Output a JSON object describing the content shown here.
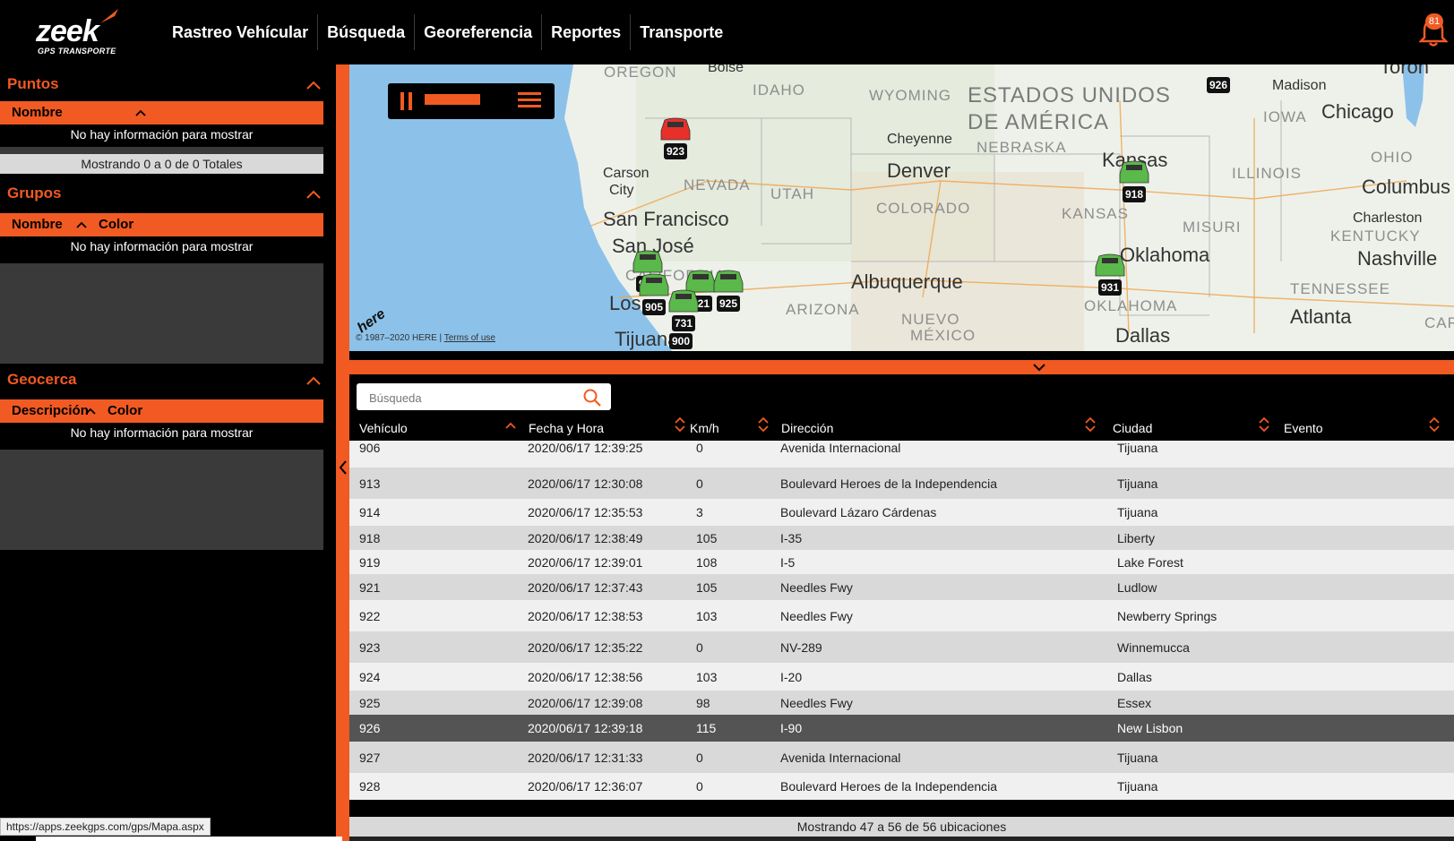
{
  "brand": {
    "logo_text": "zeek",
    "logo_sub": "GPS TRANSPORTE",
    "accent_color": "#f15a22"
  },
  "nav": {
    "items": [
      "Rastreo Vehícular",
      "Búsqueda",
      "Georeferencia",
      "Reportes",
      "Transporte"
    ]
  },
  "notifications": {
    "count": "81"
  },
  "left": {
    "puntos": {
      "title": "Puntos",
      "col1": "Nombre",
      "empty": "No hay información para mostrar",
      "footer": "Mostrando 0 a 0 de 0 Totales"
    },
    "grupos": {
      "title": "Grupos",
      "col1": "Nombre",
      "col2": "Color",
      "empty": "No hay información para mostrar"
    },
    "geocerca": {
      "title": "Geocerca",
      "col1": "Descripción",
      "col2": "Color",
      "empty": "No hay información para mostrar"
    }
  },
  "map": {
    "copyright": "© 1987–2020 HERE |",
    "terms": "Terms of use",
    "here_logo": "here",
    "labels": [
      {
        "text": "OREGON",
        "kind": "state"
      },
      {
        "text": "Boise",
        "kind": "city"
      },
      {
        "text": "IDAHO",
        "kind": "state"
      },
      {
        "text": "WYOMING",
        "kind": "state"
      },
      {
        "text": "ESTADOS UNIDOS",
        "kind": "country"
      },
      {
        "text": "DE AMÉRICA",
        "kind": "country"
      },
      {
        "text": "IOWA",
        "kind": "state"
      },
      {
        "text": "Madison",
        "kind": "city"
      },
      {
        "text": "Chicago",
        "kind": "bigcity"
      },
      {
        "text": "Cheyenne",
        "kind": "city"
      },
      {
        "text": "NEBRASKA",
        "kind": "state"
      },
      {
        "text": "Carson",
        "kind": "city"
      },
      {
        "text": "City",
        "kind": "city"
      },
      {
        "text": "NEVADA",
        "kind": "state"
      },
      {
        "text": "Denver",
        "kind": "bigcity"
      },
      {
        "text": "Kansas",
        "kind": "bigcity"
      },
      {
        "text": "ILLINOIS",
        "kind": "state"
      },
      {
        "text": "OHIO",
        "kind": "state"
      },
      {
        "text": "Columbus",
        "kind": "bigcity"
      },
      {
        "text": "UTAH",
        "kind": "state"
      },
      {
        "text": "San Francisco",
        "kind": "bigcity"
      },
      {
        "text": "COLORADO",
        "kind": "state"
      },
      {
        "text": "KANSAS",
        "kind": "state"
      },
      {
        "text": "MISURI",
        "kind": "state"
      },
      {
        "text": "Charleston",
        "kind": "city"
      },
      {
        "text": "KENTUCKY",
        "kind": "state"
      },
      {
        "text": "San José",
        "kind": "bigcity"
      },
      {
        "text": "Oklahoma",
        "kind": "bigcity"
      },
      {
        "text": "Nashville",
        "kind": "bigcity"
      },
      {
        "text": "CALIFORNIA",
        "kind": "state"
      },
      {
        "text": "Albuquerque",
        "kind": "bigcity"
      },
      {
        "text": "TENNESSEE",
        "kind": "state"
      },
      {
        "text": "Los",
        "kind": "bigcity"
      },
      {
        "text": "ARIZONA",
        "kind": "state"
      },
      {
        "text": "NUEVO",
        "kind": "state"
      },
      {
        "text": "OKLAHOMA",
        "kind": "state"
      },
      {
        "text": "Atlanta",
        "kind": "bigcity"
      },
      {
        "text": "MÉXICO",
        "kind": "state"
      },
      {
        "text": "Dallas",
        "kind": "bigcity"
      },
      {
        "text": "Tijuana",
        "kind": "bigcity"
      },
      {
        "text": "Toron",
        "kind": "bigcity"
      },
      {
        "text": "CARO",
        "kind": "state"
      }
    ],
    "vehicles": [
      {
        "id": "926",
        "status": "none"
      },
      {
        "id": "923",
        "status": "red"
      },
      {
        "id": "918",
        "status": "green"
      },
      {
        "id": "903",
        "status": "green"
      },
      {
        "id": "905",
        "status": "green"
      },
      {
        "id": "921",
        "status": "green"
      },
      {
        "id": "925",
        "status": "green"
      },
      {
        "id": "931",
        "status": "green"
      },
      {
        "id": "731",
        "status": "green"
      },
      {
        "id": "900",
        "status": "red"
      }
    ]
  },
  "table": {
    "search_placeholder": "Búsqueda",
    "headers": [
      "Vehículo",
      "Fecha y Hora",
      "Km/h",
      "Dirección",
      "Ciudad",
      "Evento"
    ],
    "rows": [
      {
        "veh": "906",
        "fecha": "2020/06/17 12:39:25",
        "kmh": "0",
        "dir": "Avenida Internacional",
        "ciudad": "Tijuana",
        "evento": ""
      },
      {
        "veh": "913",
        "fecha": "2020/06/17 12:30:08",
        "kmh": "0",
        "dir": "Boulevard Heroes de la Independencia",
        "ciudad": "Tijuana",
        "evento": ""
      },
      {
        "veh": "914",
        "fecha": "2020/06/17 12:35:53",
        "kmh": "3",
        "dir": "Boulevard Lázaro Cárdenas",
        "ciudad": "Tijuana",
        "evento": ""
      },
      {
        "veh": "918",
        "fecha": "2020/06/17 12:38:49",
        "kmh": "105",
        "dir": "I-35",
        "ciudad": "Liberty",
        "evento": ""
      },
      {
        "veh": "919",
        "fecha": "2020/06/17 12:39:01",
        "kmh": "108",
        "dir": "I-5",
        "ciudad": "Lake Forest",
        "evento": ""
      },
      {
        "veh": "921",
        "fecha": "2020/06/17 12:37:43",
        "kmh": "105",
        "dir": "Needles Fwy",
        "ciudad": "Ludlow",
        "evento": ""
      },
      {
        "veh": "922",
        "fecha": "2020/06/17 12:38:53",
        "kmh": "103",
        "dir": "Needles Fwy",
        "ciudad": "Newberry Springs",
        "evento": ""
      },
      {
        "veh": "923",
        "fecha": "2020/06/17 12:35:22",
        "kmh": "0",
        "dir": "NV-289",
        "ciudad": "Winnemucca",
        "evento": ""
      },
      {
        "veh": "924",
        "fecha": "2020/06/17 12:38:56",
        "kmh": "103",
        "dir": "I-20",
        "ciudad": "Dallas",
        "evento": ""
      },
      {
        "veh": "925",
        "fecha": "2020/06/17 12:39:08",
        "kmh": "98",
        "dir": "Needles Fwy",
        "ciudad": "Essex",
        "evento": ""
      },
      {
        "veh": "926",
        "fecha": "2020/06/17 12:39:18",
        "kmh": "115",
        "dir": "I-90",
        "ciudad": "New Lisbon",
        "evento": ""
      },
      {
        "veh": "927",
        "fecha": "2020/06/17 12:31:33",
        "kmh": "0",
        "dir": "Avenida Internacional",
        "ciudad": "Tijuana",
        "evento": ""
      },
      {
        "veh": "928",
        "fecha": "2020/06/17 12:36:07",
        "kmh": "0",
        "dir": "Boulevard Heroes de la Independencia",
        "ciudad": "Tijuana",
        "evento": ""
      }
    ],
    "selected_vehicle": "926",
    "footer": "Mostrando 47 a 56 de 56 ubicaciones"
  },
  "statusbar": {
    "url": "https://apps.zeekgps.com/gps/Mapa.aspx"
  }
}
